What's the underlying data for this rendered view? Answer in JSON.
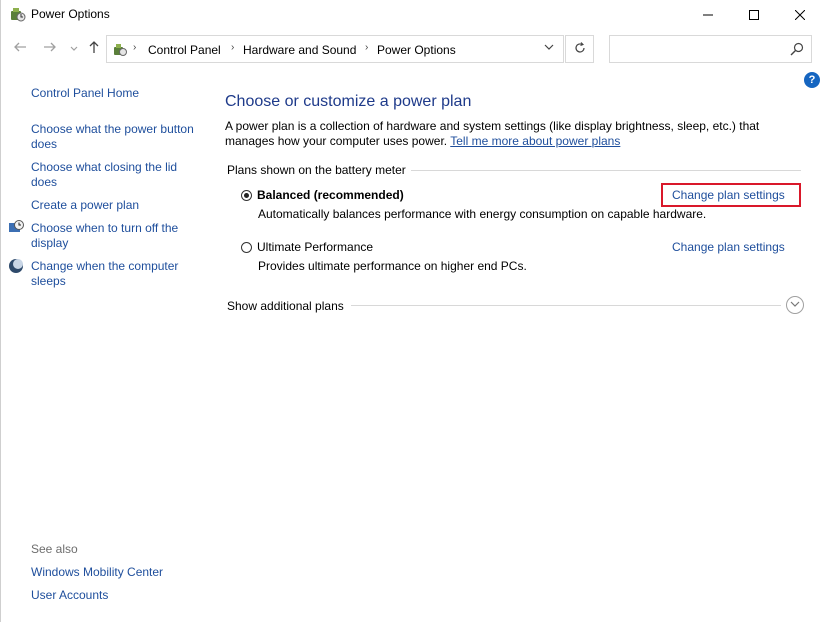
{
  "window": {
    "title": "Power Options"
  },
  "address": {
    "breadcrumbs": [
      "Control Panel",
      "Hardware and Sound",
      "Power Options"
    ],
    "search_placeholder": ""
  },
  "leftpane": {
    "home": "Control Panel Home",
    "links": [
      "Choose what the power button does",
      "Choose what closing the lid does",
      "Create a power plan",
      "Choose when to turn off the display",
      "Change when the computer sleeps"
    ],
    "see_also_label": "See also",
    "see_also": [
      "Windows Mobility Center",
      "User Accounts"
    ]
  },
  "main": {
    "title": "Choose or customize a power plan",
    "description": "A power plan is a collection of hardware and system settings (like display brightness, sleep, etc.) that manages how your computer uses power.",
    "learn_more": "Tell me more about power plans",
    "group_label": "Plans shown on the battery meter",
    "plans": [
      {
        "name": "Balanced (recommended)",
        "desc": "Automatically balances performance with energy consumption on capable hardware.",
        "selected": true,
        "action": "Change plan settings"
      },
      {
        "name": "Ultimate Performance",
        "desc": "Provides ultimate performance on higher end PCs.",
        "selected": false,
        "action": "Change plan settings"
      }
    ],
    "show_additional": "Show additional plans"
  },
  "icons": {
    "back": "back-arrow-icon",
    "forward": "forward-arrow-icon",
    "up": "up-arrow-icon",
    "refresh": "refresh-icon",
    "search": "search-icon",
    "help": "help-icon"
  },
  "colors": {
    "link": "#1e4e9c",
    "title": "#1e3a8a",
    "highlight": "#d9182a",
    "help": "#1565c0"
  }
}
